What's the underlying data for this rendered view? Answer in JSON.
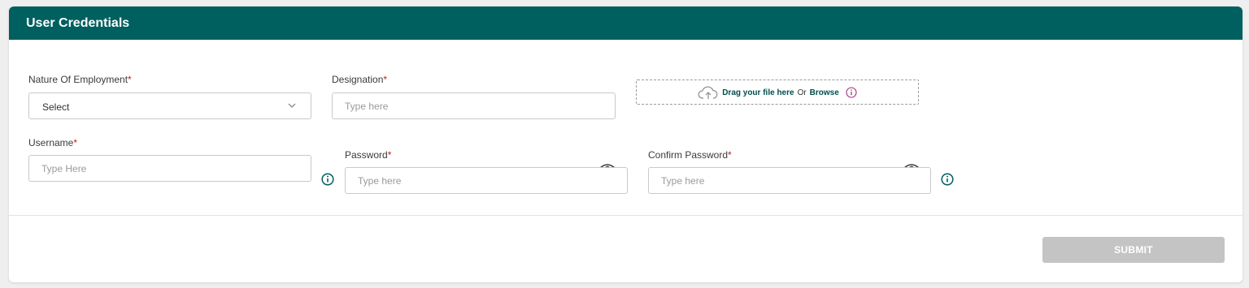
{
  "header": {
    "title": "User Credentials"
  },
  "form": {
    "employment": {
      "label": "Nature Of Employment",
      "required_mark": "*",
      "value": "Select"
    },
    "designation": {
      "label": "Designation",
      "required_mark": "*",
      "placeholder": "Type here"
    },
    "upload": {
      "drag_text": "Drag your file here",
      "or_text": "Or",
      "browse_text": "Browse"
    },
    "username": {
      "label": "Username",
      "required_mark": "*",
      "placeholder": "Type Here"
    },
    "password": {
      "label": "Password",
      "required_mark": "*",
      "placeholder": "Type here"
    },
    "confirm_password": {
      "label": "Confirm Password",
      "required_mark": "*",
      "placeholder": "Type here"
    }
  },
  "actions": {
    "submit_label": "SUBMIT"
  },
  "icons": {
    "upload": "cloud-upload-icon",
    "info": "info-icon",
    "eye": "eye-icon",
    "chevron": "chevron-down-icon"
  },
  "colors": {
    "header_bg": "#005f5f",
    "accent": "#004d4d",
    "required": "#b3261e",
    "submit_disabled": "#c4c4c4",
    "upload_info": "#a0307a"
  }
}
